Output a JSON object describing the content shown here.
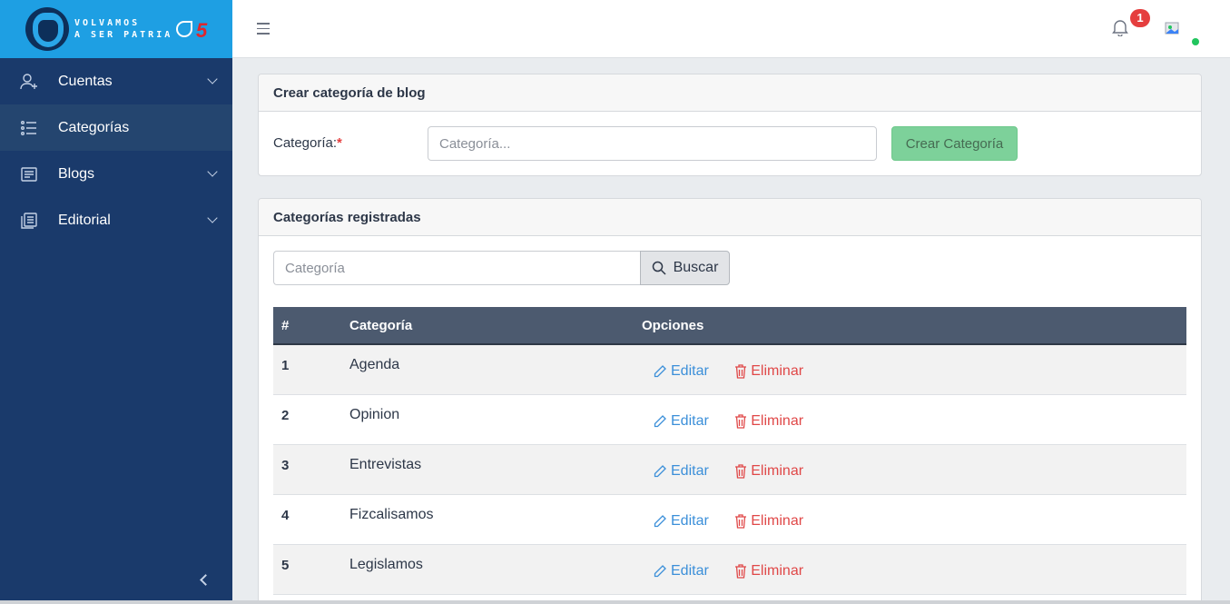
{
  "brand": {
    "text_line1": "VOLVAMOS",
    "text_line2": "A SER PATRIA",
    "mark_number": "5"
  },
  "sidebar": {
    "items": [
      {
        "label": "Cuentas",
        "icon": "user-add-icon",
        "has_submenu": true,
        "active": false
      },
      {
        "label": "Categorías",
        "icon": "list-icon",
        "has_submenu": false,
        "active": true
      },
      {
        "label": "Blogs",
        "icon": "document-icon",
        "has_submenu": true,
        "active": false
      },
      {
        "label": "Editorial",
        "icon": "copy-icon",
        "has_submenu": true,
        "active": false
      }
    ]
  },
  "topbar": {
    "notification_count": "1"
  },
  "create_card": {
    "title": "Crear categoría de blog",
    "field_label": "Categoría:",
    "required_mark": "*",
    "placeholder": "Categoría...",
    "submit_label": "Crear Categoría"
  },
  "list_card": {
    "title": "Categorías registradas",
    "search_placeholder": "Categoría",
    "search_label": "Buscar",
    "columns": [
      "#",
      "Categoría",
      "Opciones"
    ],
    "edit_label": "Editar",
    "delete_label": "Eliminar",
    "rows": [
      {
        "id": "1",
        "name": "Agenda"
      },
      {
        "id": "2",
        "name": "Opinion"
      },
      {
        "id": "3",
        "name": "Entrevistas"
      },
      {
        "id": "4",
        "name": "Fizcalisamos"
      },
      {
        "id": "5",
        "name": "Legislamos"
      }
    ]
  },
  "colors": {
    "sidebar_bg": "#1a3a6b",
    "brand_bg": "#1e9fe3",
    "table_header_bg": "#4c5a6f",
    "create_button": "#7dd19a",
    "edit_link": "#3b8fd9",
    "delete_link": "#e04848",
    "badge": "#e53e3e",
    "online": "#22c55e"
  }
}
